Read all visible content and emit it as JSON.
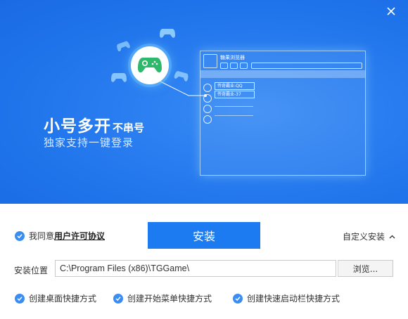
{
  "banner": {
    "headline_big": "小号多开",
    "headline_small": "不串号",
    "subline": "独家支持一键登录",
    "mock": {
      "title": "糖果浏览器",
      "accounts": [
        "传奇霸业-QQ",
        "传奇霸业-37"
      ]
    }
  },
  "agreement": {
    "prefix": "我同意",
    "link": "用户许可协议",
    "checked": true
  },
  "install_button": "安装",
  "custom_install": "自定义安装",
  "path": {
    "label": "安装位置",
    "value": "C:\\Program Files (x86)\\TGGame\\"
  },
  "browse_button": "浏览...",
  "options": [
    {
      "label": "创建桌面快捷方式",
      "checked": true
    },
    {
      "label": "创建开始菜单快捷方式",
      "checked": true
    },
    {
      "label": "创建快速启动栏快捷方式",
      "checked": true
    }
  ],
  "colors": {
    "banner": "#2a7ef0",
    "accent": "#1d7bf2",
    "check": "#3a8ef2"
  },
  "icons": {
    "close": "close-icon",
    "gamepad": "gamepad-icon",
    "check": "check-icon",
    "chevron": "chevron-up-icon"
  }
}
